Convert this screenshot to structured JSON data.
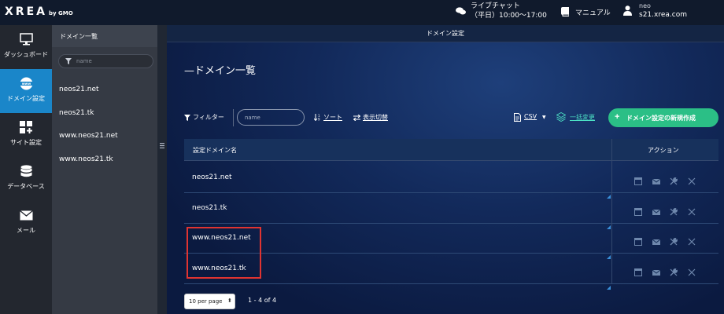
{
  "topbar": {
    "logo": "XREA",
    "logo_sub": "by GMO",
    "chat_label": "ライブチャット",
    "chat_hours": "（平日）10:00〜17:00",
    "manual_label": "マニュアル",
    "user_name": "neo",
    "user_server": "s21.xrea.com"
  },
  "leftnav": {
    "items": [
      {
        "label": "ダッシュボード",
        "icon": "monitor-icon"
      },
      {
        "label": "ドメイン設定",
        "icon": "www-icon",
        "active": true
      },
      {
        "label": "サイト設定",
        "icon": "grid-plus-icon"
      },
      {
        "label": "データベース",
        "icon": "database-icon"
      },
      {
        "label": "メール",
        "icon": "mail-icon"
      }
    ]
  },
  "panel": {
    "title": "ドメイン一覧",
    "search_placeholder": "name",
    "items": [
      "neos21.net",
      "neos21.tk",
      "www.neos21.net",
      "www.neos21.tk"
    ]
  },
  "main": {
    "header_title": "ドメイン設定",
    "page_title": "—ドメイン一覧"
  },
  "toolbar": {
    "filter_label": "フィルター",
    "name_placeholder": "name",
    "sort_label": "ソート",
    "switch_label": "表示切替",
    "csv_label": "CSV",
    "bulk_label": "一括変更",
    "new_label": "ドメイン設定の新規作成"
  },
  "table": {
    "header_name": "設定ドメイン名",
    "header_action": "アクション",
    "rows": [
      "neos21.net",
      "neos21.tk",
      "www.neos21.net",
      "www.neos21.tk"
    ]
  },
  "footer": {
    "per_page": "10 per page",
    "pager_text": "1 - 4 of 4"
  },
  "colors": {
    "accent_active": "#1a86c9",
    "new_button": "#2bbf86",
    "bulk_link": "#4ce2c4",
    "highlight": "#e03431"
  }
}
